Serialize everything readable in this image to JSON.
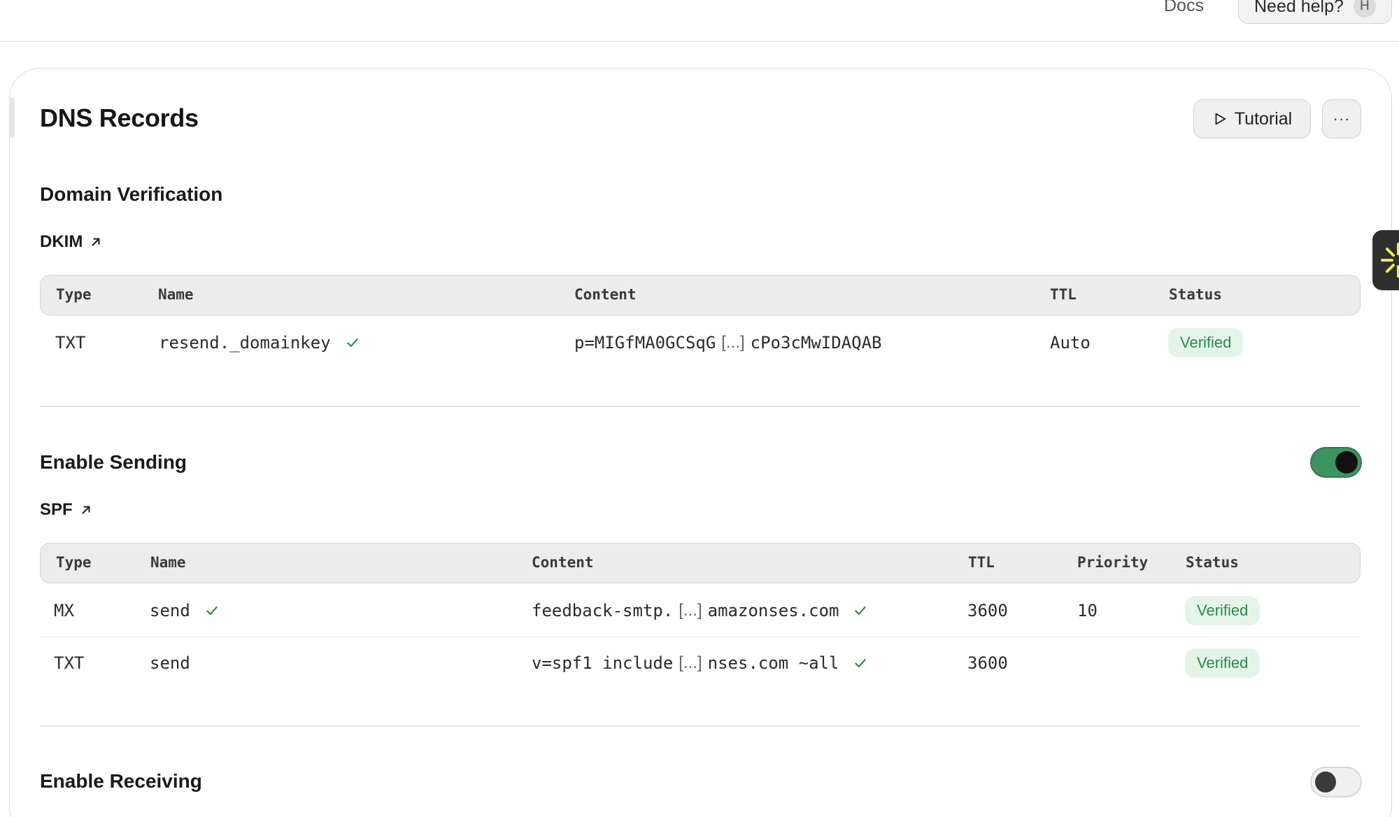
{
  "topbar": {
    "docs_label": "Docs",
    "help_label": "Need help?",
    "help_shortcut": "H"
  },
  "page": {
    "title": "DNS Records",
    "tutorial_label": "Tutorial",
    "more_label": "···"
  },
  "domain_verification": {
    "title": "Domain Verification",
    "record_label": "DKIM",
    "columns": [
      "Type",
      "Name",
      "Content",
      "TTL",
      "Status"
    ],
    "rows": [
      {
        "type": "TXT",
        "name": "resend._domainkey",
        "content_start": "p=MIGfMA0GCSqG",
        "content_ellipsis": "[...]",
        "content_end": "cPo3cMwIDAQAB",
        "ttl": "Auto",
        "status": "Verified"
      }
    ]
  },
  "enable_sending": {
    "title": "Enable Sending",
    "enabled": true,
    "record_label": "SPF",
    "columns": [
      "Type",
      "Name",
      "Content",
      "TTL",
      "Priority",
      "Status"
    ],
    "rows": [
      {
        "type": "MX",
        "name": "send",
        "content_start": "feedback-smtp.",
        "content_ellipsis": "[...]",
        "content_end": "amazonses.com",
        "ttl": "3600",
        "priority": "10",
        "status": "Verified"
      },
      {
        "type": "TXT",
        "name": "send",
        "content_start": "v=spf1 include",
        "content_ellipsis": "[...]",
        "content_end": "nses.com ~all",
        "ttl": "3600",
        "priority": "",
        "status": "Verified"
      }
    ]
  },
  "enable_receiving": {
    "title": "Enable Receiving",
    "enabled": false
  },
  "colors": {
    "verified_text": "#2b8a4b",
    "verified_bg": "#e5f4e9",
    "toggle_on": "#3d9461",
    "widget_accent": "#e6f04a"
  },
  "icons": {
    "external": "arrow-up-right-icon",
    "check": "check-icon",
    "play": "play-icon",
    "widget": "sparkle-icon"
  }
}
